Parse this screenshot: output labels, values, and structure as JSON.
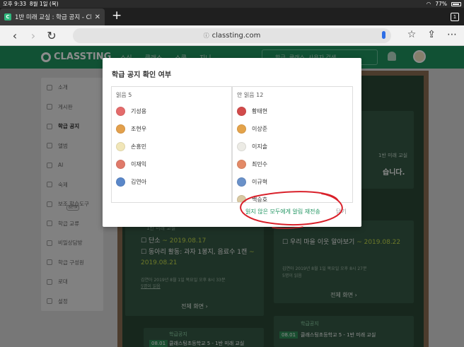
{
  "status_bar": {
    "time": "오후 9:33",
    "date": "8월 1일 (목)",
    "battery": "77%"
  },
  "browser": {
    "tab_title": "1반 미래 교실 : 학급 공지 - Classting",
    "tab_count": "1",
    "url": "classting.com"
  },
  "site": {
    "logo": "CLASSTING",
    "menus": [
      "소식",
      "클래스",
      "스쿨",
      "지니"
    ],
    "search_placeholder": "학급, 클래스, 사용자 검색"
  },
  "sidebar": {
    "items": [
      {
        "label": "소개"
      },
      {
        "label": "게시판"
      },
      {
        "label": "학급 공지"
      },
      {
        "label": "앨범"
      },
      {
        "label": "AI"
      },
      {
        "label": "숙제"
      },
      {
        "label": "보조 학습도구"
      },
      {
        "label": "학급 교류"
      },
      {
        "label": "비밀상담방"
      },
      {
        "label": "학급 구성원"
      },
      {
        "label": "로대"
      },
      {
        "label": "설정"
      }
    ],
    "beta": "BETA"
  },
  "board": {
    "right_top": {
      "label": "1반 미래 교실",
      "heading": "습니다."
    },
    "left_card": {
      "label": "1반 미래 교실",
      "item1": "단소",
      "item1_date": "~ 2019.08.17",
      "item2": "동아리 활동: 과자 1봉지, 음료수 1캔",
      "item2_date": "~ 2019.08.21",
      "meta": "김연아 2019년 8월 1일 목요일 오후 8시 33분",
      "readers": "5명이 읽음",
      "footer": "전체 화면"
    },
    "right_card": {
      "item1": "우리 마을 이웃 알아보기",
      "item1_date": "~ 2019.08.22",
      "meta": "김연아 2019년 8월 1일 목요일 오후 8시 27분",
      "readers": "5명이 읽음",
      "footer": "전체 화면"
    },
    "bottom_left": {
      "badge": "학급공지",
      "num": "08.01",
      "text": "클래스팅초등학교 5 - 1반 미래 교실"
    },
    "bottom_right": {
      "badge": "학급공지",
      "num": "08.01",
      "text": "클래스팅초등학교 5 - 1반 미래 교실"
    }
  },
  "modal": {
    "title": "학급 공지 확인 여부",
    "read_header": "읽음 5",
    "unread_header": "안 읽음 12",
    "read": [
      {
        "name": "기성용",
        "color": "#e46b6b"
      },
      {
        "name": "조현우",
        "color": "#e3a04c"
      },
      {
        "name": "손흥민",
        "color": "#f1e6b8"
      },
      {
        "name": "이재익",
        "color": "#e07a6a"
      },
      {
        "name": "김연아",
        "color": "#5a87c9"
      }
    ],
    "unread": [
      {
        "name": "황태현",
        "color": "#d24b4b"
      },
      {
        "name": "이상준",
        "color": "#e4a34a"
      },
      {
        "name": "이지솔",
        "color": "#ecebe5"
      },
      {
        "name": "최민수",
        "color": "#e38a67"
      },
      {
        "name": "이규혁",
        "color": "#6a91c9"
      },
      {
        "name": "백승호",
        "color": "#d9c9a2"
      }
    ],
    "resend": "읽지 않은 모두에게 알림 재전송",
    "close": "닫기"
  },
  "colors": {
    "brand": "#1f9460",
    "ink": "#d9202a"
  }
}
